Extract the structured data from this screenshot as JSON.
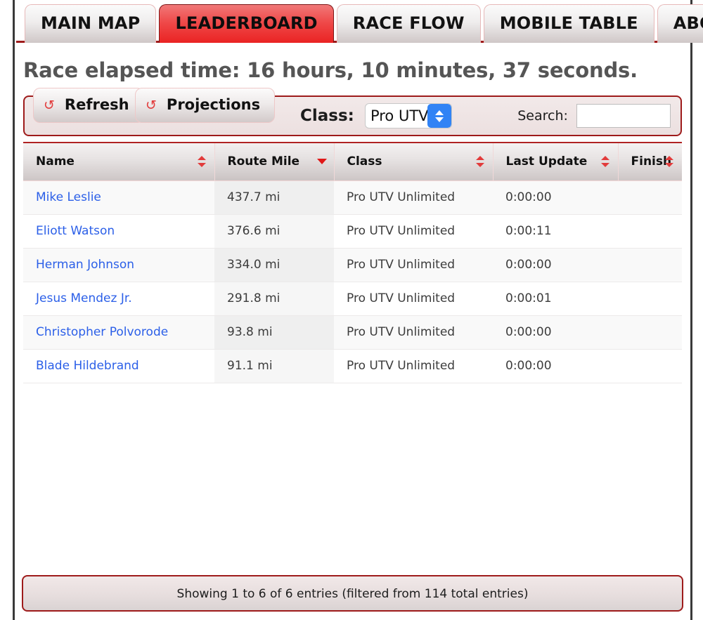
{
  "tabs": [
    {
      "label": "MAIN MAP",
      "active": false
    },
    {
      "label": "LEADERBOARD",
      "active": true
    },
    {
      "label": "RACE FLOW",
      "active": false
    },
    {
      "label": "MOBILE TABLE",
      "active": false
    },
    {
      "label": "ABOUT",
      "active": false
    }
  ],
  "heading": "Race elapsed time: 16 hours, 10 minutes, 37 seconds.",
  "toolbar": {
    "refresh_label": "Refresh",
    "projections_label": "Projections",
    "refresh_icon": "refresh-circular-arrow-icon",
    "class_label": "Class:",
    "class_selected": "Pro UTV Unlimited",
    "search_label": "Search:",
    "search_value": "",
    "search_placeholder": ""
  },
  "table": {
    "columns": [
      {
        "label": "Name",
        "sort": "both"
      },
      {
        "label": "Route Mile",
        "sort": "desc"
      },
      {
        "label": "Class",
        "sort": "both"
      },
      {
        "label": "Last Update",
        "sort": "both"
      },
      {
        "label": "Finish",
        "sort": "both"
      }
    ],
    "rows": [
      {
        "name": "Mike Leslie",
        "route_mile": "437.7 mi",
        "class": "Pro UTV Unlimited",
        "last_update": "0:00:00",
        "finish": ""
      },
      {
        "name": "Eliott Watson",
        "route_mile": "376.6 mi",
        "class": "Pro UTV Unlimited",
        "last_update": "0:00:11",
        "finish": ""
      },
      {
        "name": "Herman Johnson",
        "route_mile": "334.0 mi",
        "class": "Pro UTV Unlimited",
        "last_update": "0:00:00",
        "finish": ""
      },
      {
        "name": "Jesus Mendez Jr.",
        "route_mile": "291.8 mi",
        "class": "Pro UTV Unlimited",
        "last_update": "0:00:01",
        "finish": ""
      },
      {
        "name": "Christopher Polvorode",
        "route_mile": "93.8 mi",
        "class": "Pro UTV Unlimited",
        "last_update": "0:00:00",
        "finish": ""
      },
      {
        "name": "Blade Hildebrand",
        "route_mile": "91.1 mi",
        "class": "Pro UTV Unlimited",
        "last_update": "0:00:00",
        "finish": ""
      }
    ]
  },
  "footer": {
    "info": "Showing 1 to 6 of 6 entries (filtered from 114 total entries)"
  },
  "colors": {
    "accent_red": "#e01818",
    "border_red": "#9e1b1b",
    "active_tab_red": "#ea2323",
    "link_blue": "#2b5fe8",
    "select_blue": "#3183f5",
    "heading_gray": "#555555"
  }
}
